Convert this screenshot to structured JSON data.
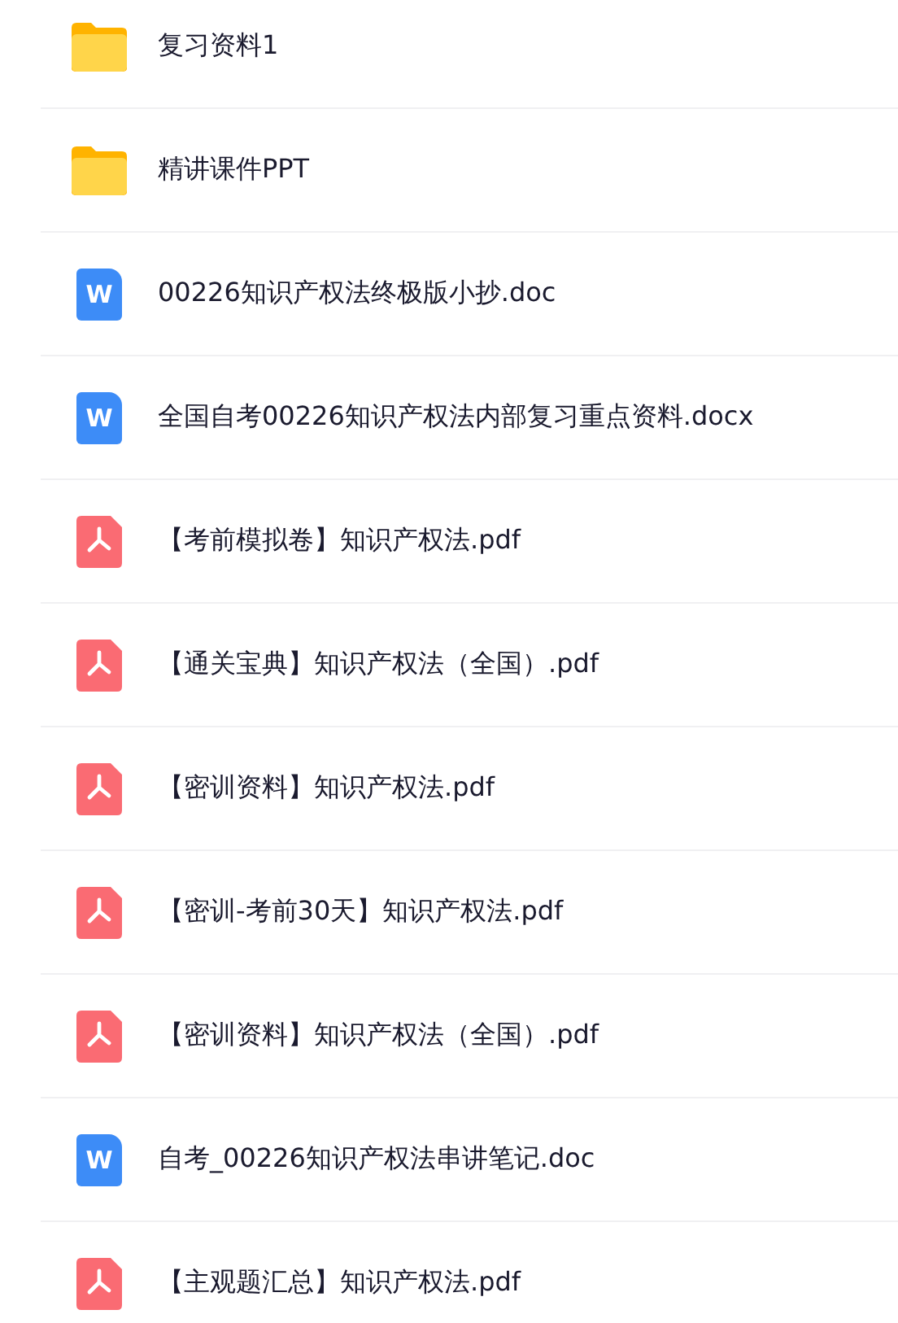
{
  "files": [
    {
      "kind": "folder",
      "name": "复习资料1"
    },
    {
      "kind": "folder",
      "name": "精讲课件PPT"
    },
    {
      "kind": "word",
      "icon_letter": "W",
      "name": "00226知识产权法终极版小抄.doc"
    },
    {
      "kind": "word",
      "icon_letter": "W",
      "name": "全国自考00226知识产权法内部复习重点资料.docx"
    },
    {
      "kind": "pdf",
      "name": "【考前模拟卷】知识产权法.pdf"
    },
    {
      "kind": "pdf",
      "name": "【通关宝典】知识产权法（全国）.pdf"
    },
    {
      "kind": "pdf",
      "name": "【密训资料】知识产权法.pdf"
    },
    {
      "kind": "pdf",
      "name": "【密训-考前30天】知识产权法.pdf"
    },
    {
      "kind": "pdf",
      "name": "【密训资料】知识产权法（全国）.pdf"
    },
    {
      "kind": "word",
      "icon_letter": "W",
      "name": "自考_00226知识产权法串讲笔记.doc"
    },
    {
      "kind": "pdf",
      "name": "【主观题汇总】知识产权法.pdf"
    }
  ]
}
